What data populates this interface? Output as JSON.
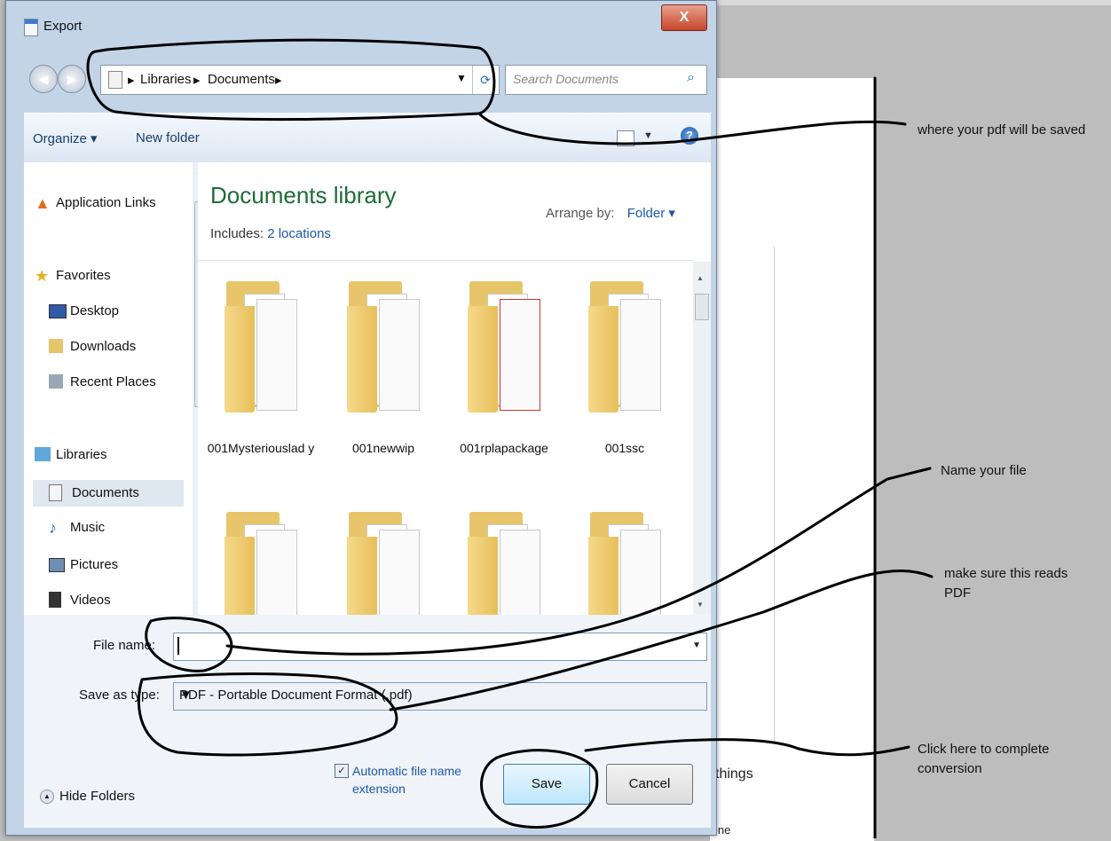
{
  "window": {
    "title": "Export",
    "close_label": "X"
  },
  "address": {
    "crumbs": [
      "Libraries",
      "Documents"
    ]
  },
  "search": {
    "placeholder": "Search Documents"
  },
  "toolbar": {
    "organize": "Organize ▾",
    "new_folder": "New folder",
    "help": "?"
  },
  "sidebar": {
    "items": [
      {
        "label": "Application Links",
        "icon": "application-links-icon"
      },
      {
        "label": "Favorites",
        "icon": "star-icon"
      },
      {
        "label": "Desktop",
        "icon": "desktop-icon"
      },
      {
        "label": "Downloads",
        "icon": "downloads-icon"
      },
      {
        "label": "Recent Places",
        "icon": "recent-places-icon"
      },
      {
        "label": "Libraries",
        "icon": "libraries-icon"
      },
      {
        "label": "Documents",
        "icon": "documents-icon",
        "selected": true
      },
      {
        "label": "Music",
        "icon": "music-icon"
      },
      {
        "label": "Pictures",
        "icon": "pictures-icon"
      },
      {
        "label": "Videos",
        "icon": "videos-icon"
      }
    ]
  },
  "library": {
    "title": "Documents library",
    "includes_label": "Includes:",
    "includes_link": "2 locations",
    "arrange_label": "Arrange by:",
    "arrange_value": "Folder ▾"
  },
  "folders": [
    {
      "name": "001Mysteriouslad y"
    },
    {
      "name": "001newwip"
    },
    {
      "name": "001rplapackage"
    },
    {
      "name": "001ssc"
    },
    {
      "name": ""
    },
    {
      "name": ""
    },
    {
      "name": ""
    },
    {
      "name": ""
    }
  ],
  "form": {
    "file_name_label": "File name:",
    "file_name_value": "",
    "save_type_label": "Save as type:",
    "save_type_value": "PDF - Portable Document Format (.pdf)",
    "auto_ext_label": "Automatic file name extension",
    "auto_ext_checked": true,
    "hide_folders": "Hide Folders",
    "save": "Save",
    "cancel": "Cancel"
  },
  "annotations": {
    "where_saved": "where your pdf will be saved",
    "name_file": "Name your file",
    "reads_pdf": "make sure this reads PDF",
    "complete": "Click here to complete conversion"
  },
  "background": {
    "text1": "things",
    "text2": "ine"
  },
  "colors": {
    "library_title": "#1e6b3a",
    "link": "#1c58a8",
    "close_button": "#c6452b",
    "window_frame": "#c3d4e7"
  }
}
